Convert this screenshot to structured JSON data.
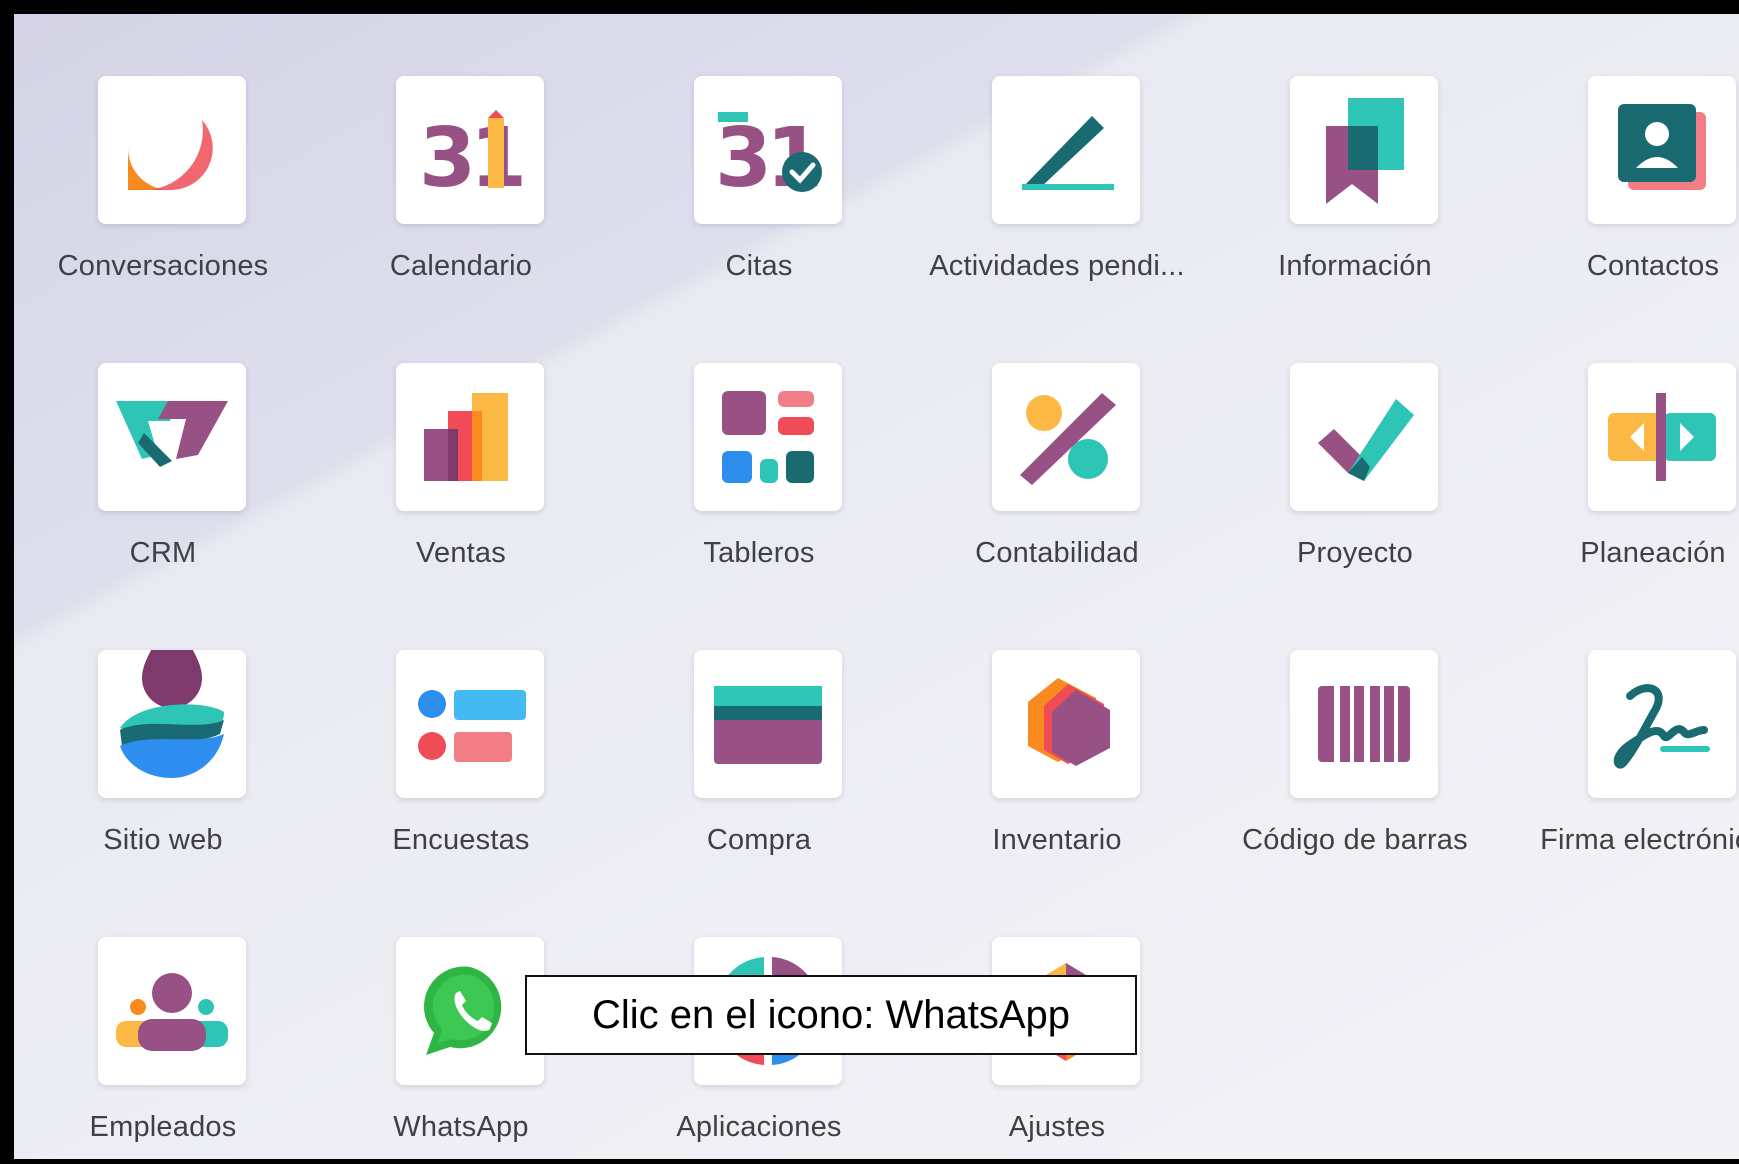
{
  "apps": [
    {
      "label": "Conversaciones",
      "icon": "conversaciones-icon"
    },
    {
      "label": "Calendario",
      "icon": "calendario-icon",
      "glyph": "31"
    },
    {
      "label": "Citas",
      "icon": "citas-icon",
      "glyph": "31"
    },
    {
      "label": "Actividades pendi...",
      "icon": "actividades-icon"
    },
    {
      "label": "Información",
      "icon": "informacion-icon"
    },
    {
      "label": "Contactos",
      "icon": "contactos-icon"
    },
    {
      "label": "CRM",
      "icon": "crm-icon"
    },
    {
      "label": "Ventas",
      "icon": "ventas-icon"
    },
    {
      "label": "Tableros",
      "icon": "tableros-icon"
    },
    {
      "label": "Contabilidad",
      "icon": "contabilidad-icon"
    },
    {
      "label": "Proyecto",
      "icon": "proyecto-icon"
    },
    {
      "label": "Planeación",
      "icon": "planeacion-icon"
    },
    {
      "label": "Sitio web",
      "icon": "sitio-web-icon"
    },
    {
      "label": "Encuestas",
      "icon": "encuestas-icon"
    },
    {
      "label": "Compra",
      "icon": "compra-icon"
    },
    {
      "label": "Inventario",
      "icon": "inventario-icon"
    },
    {
      "label": "Código de barras",
      "icon": "codigo-barras-icon"
    },
    {
      "label": "Firma electrónica",
      "icon": "firma-icon"
    },
    {
      "label": "Empleados",
      "icon": "empleados-icon"
    },
    {
      "label": "WhatsApp",
      "icon": "whatsapp-icon"
    },
    {
      "label": "Aplicaciones",
      "icon": "aplicaciones-icon"
    },
    {
      "label": "Ajustes",
      "icon": "ajustes-icon"
    }
  ],
  "tooltip": {
    "text": "Clic en el icono: WhatsApp"
  },
  "colors": {
    "purple": "#985184",
    "teal": "#2ec4b6",
    "dark_teal": "#1a6a72",
    "orange": "#f98a1f",
    "yellow": "#fbb845",
    "pink": "#f27d86",
    "red": "#f04b57",
    "blue": "#2d8ef0",
    "whatsapp_green": "#2fb543"
  }
}
